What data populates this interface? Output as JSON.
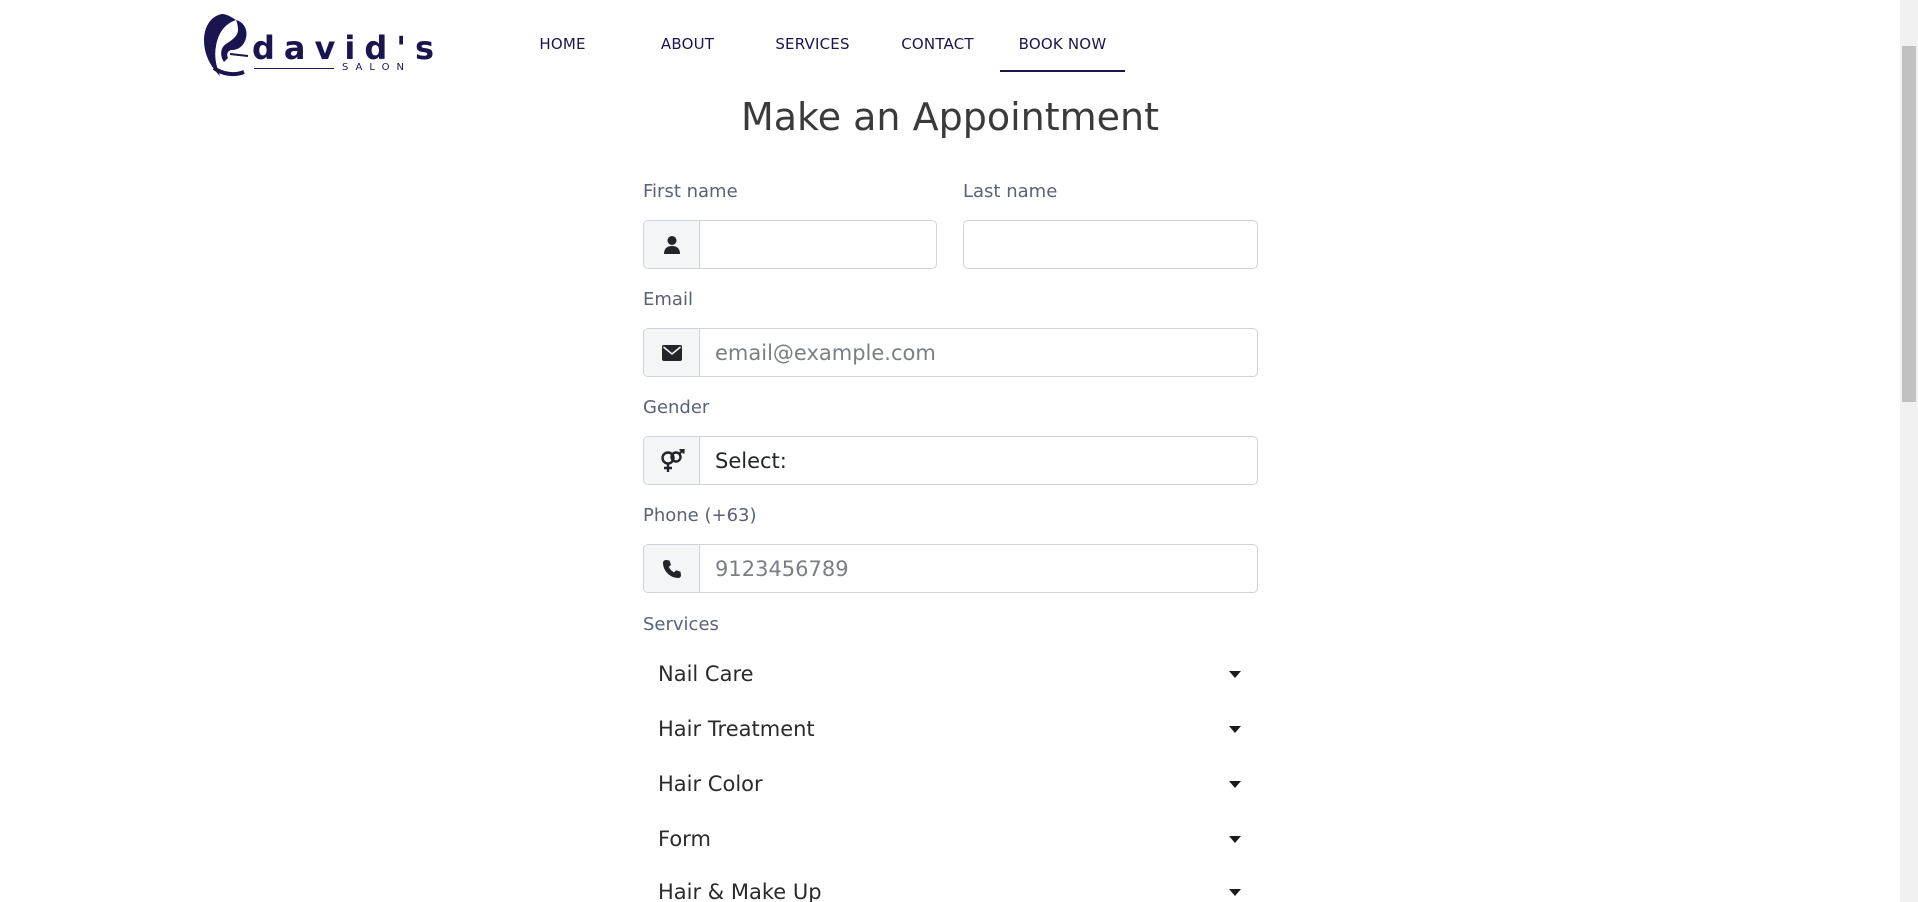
{
  "brand": {
    "name": "david's",
    "sub": "SALON"
  },
  "nav": {
    "home": "HOME",
    "about": "ABOUT",
    "services": "SERVICES",
    "contact": "CONTACT",
    "book_now": "BOOK NOW",
    "active": "BOOK NOW"
  },
  "title": "Make an Appointment",
  "form": {
    "first_name": {
      "label": "First name",
      "value": ""
    },
    "last_name": {
      "label": "Last name",
      "value": ""
    },
    "email": {
      "label": "Email",
      "placeholder": "email@example.com"
    },
    "gender": {
      "label": "Gender",
      "selected": "Select:"
    },
    "phone": {
      "label": "Phone (+63)",
      "placeholder": "9123456789"
    },
    "services": {
      "label": "Services",
      "items": [
        "Nail Care",
        "Hair Treatment",
        "Hair Color",
        "Form",
        "Hair & Make Up"
      ]
    }
  },
  "icons": {
    "first_name": "user-icon",
    "email": "envelope-icon",
    "gender": "gender-icon",
    "phone": "phone-icon",
    "services_toggle": "caret-down-icon"
  },
  "colors": {
    "brand": "#1a1550",
    "label": "#5a6275",
    "border": "#ced4da"
  }
}
